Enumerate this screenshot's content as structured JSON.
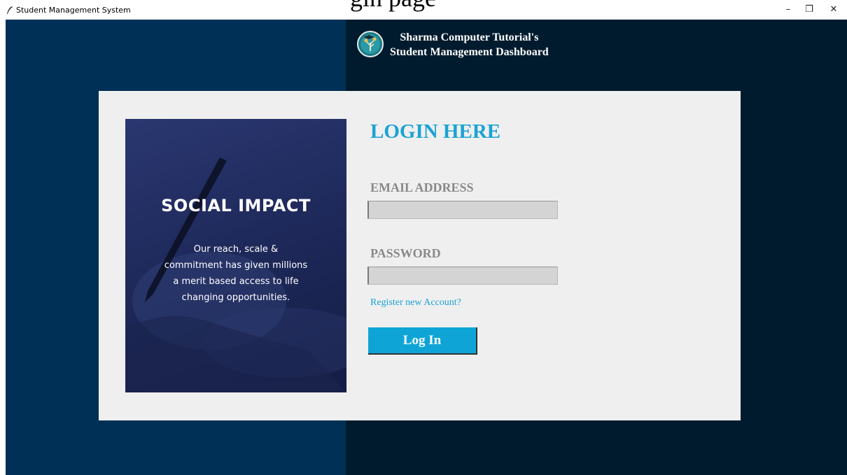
{
  "window": {
    "title": "Student Management System",
    "overlay_caption": "gin page",
    "controls": {
      "minimize": "–",
      "maximize": "❐",
      "close": "✕"
    }
  },
  "header": {
    "line1": "Sharma Computer Tutorial's",
    "line2": "Student Management Dashboard",
    "logo_icon": "graduate-tree-logo-icon"
  },
  "promo": {
    "title": "SOCIAL IMPACT",
    "body": "Our reach, scale &\ncommitment has given millions\na merit based access to life\nchanging opportunities."
  },
  "login": {
    "heading": "LOGIN HERE",
    "email_label": "EMAIL ADDRESS",
    "email_value": "",
    "password_label": "PASSWORD",
    "password_value": "",
    "register_link": "Register new Account?",
    "button": "Log In"
  },
  "colors": {
    "left_bg": "#003056",
    "right_bg": "#001b2e",
    "panel_bg": "#efefef",
    "accent": "#1ba3d4",
    "button_bg": "#0ea5d6",
    "label_gray": "#898989"
  }
}
